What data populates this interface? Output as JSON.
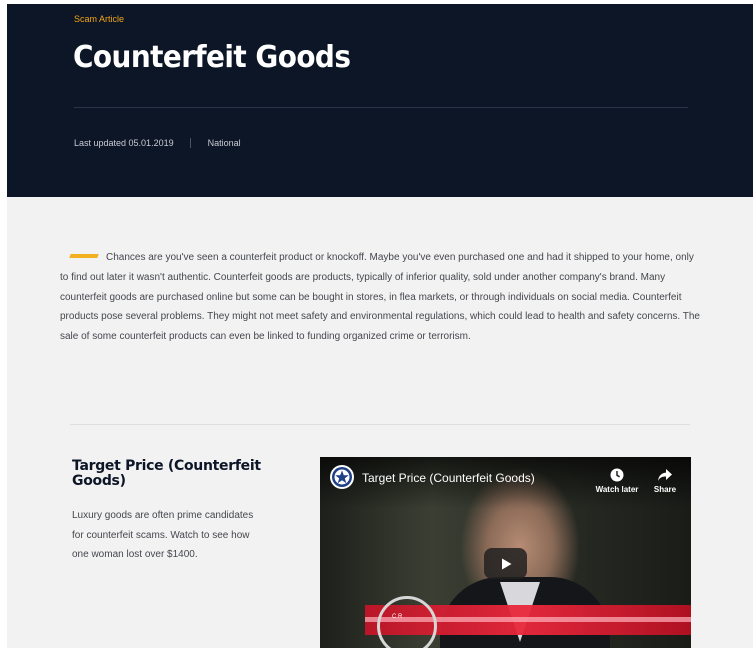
{
  "hero": {
    "category": "Scam Article",
    "title": "Counterfeit Goods",
    "updated": "Last updated 05.01.2019",
    "region": "National"
  },
  "intro": {
    "text": "Chances are you've seen a counterfeit product or knockoff. Maybe you've even purchased one and had it shipped to your home, only to find out later it wasn't authentic. Counterfeit goods are products, typically of inferior quality, sold under another company's brand. Many counterfeit goods are purchased online but some can be bought in stores, in flea markets, or through individuals on social media. Counterfeit products pose several problems. They might not meet safety and environmental regulations, which could lead to health and safety concerns. The sale of some counterfeit products can even be linked to funding organized crime or terrorism."
  },
  "video_section": {
    "title": "Target Price (Counterfeit Goods)",
    "description": "Luxury goods are often prime candidates for counterfeit scams. Watch to see how one woman lost over $1400."
  },
  "player": {
    "video_title": "Target Price (Counterfeit Goods)",
    "watch_later": "Watch later",
    "share": "Share",
    "overlay_text": "C          R",
    "icons": {
      "channel": "star-seal-icon",
      "watch_later": "clock-icon",
      "share": "share-arrow-icon",
      "play": "play-icon"
    }
  },
  "colors": {
    "hero_bg": "#0c1627",
    "accent": "#f2a516",
    "page_bg": "#f2f2f2"
  }
}
